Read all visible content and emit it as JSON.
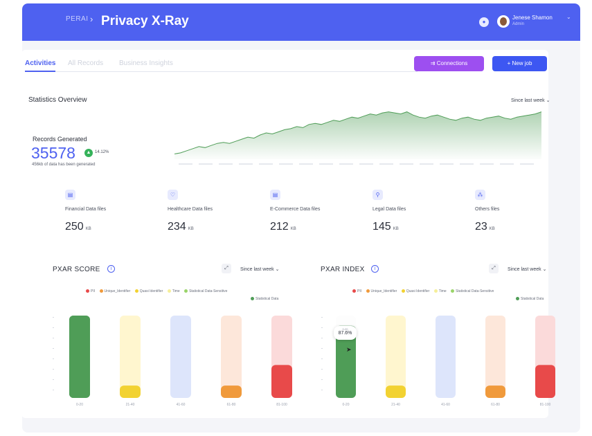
{
  "header": {
    "breadcrumb_root": "PERAI",
    "breadcrumb_sep": "›",
    "title": "Privacy X-Ray",
    "user_name": "Jenese Shamon",
    "user_role": "Admin",
    "icons": [
      "bell-icon",
      "avatar",
      "chevron-down-icon"
    ]
  },
  "tabs": [
    {
      "label": "Activities",
      "active": true
    },
    {
      "label": "All Records",
      "active": false
    },
    {
      "label": "Business Insights",
      "active": false
    }
  ],
  "actions": {
    "connections_label": "⇉ Connections",
    "new_job_label": "+ New job"
  },
  "overview": {
    "title": "Statistics Overview",
    "range": "Since last week ⌄",
    "records_label": "Records Generated",
    "records_value": "35578",
    "growth": "14.12%",
    "sub": "456kb of data has been generated"
  },
  "stats": [
    {
      "label": "Financial Data files",
      "value": "250",
      "unit": "KB",
      "icon": "▤"
    },
    {
      "label": "Healthcare Data files",
      "value": "234",
      "unit": "KB",
      "icon": "♡"
    },
    {
      "label": "E-Commerce Data files",
      "value": "212",
      "unit": "KB",
      "icon": "▤"
    },
    {
      "label": "Legal Data files",
      "value": "145",
      "unit": "KB",
      "icon": "⚲"
    },
    {
      "label": "Others files",
      "value": "23",
      "unit": "KB",
      "icon": "⁂"
    }
  ],
  "score": {
    "title": "PXAR SCORE",
    "range": "Since last week ⌄"
  },
  "index": {
    "title": "PXAR INDEX",
    "range": "Since last week ⌄"
  },
  "legend": [
    {
      "label": "PII",
      "color": "#e84a4a"
    },
    {
      "label": "Unique_Identifier",
      "color": "#f09a3c"
    },
    {
      "label": "Quasi Identifier",
      "color": "#f2d232"
    },
    {
      "label": "Time",
      "color": "#f5ef9a"
    },
    {
      "label": "Statistical Data-Sensitive",
      "color": "#9ad46a"
    },
    {
      "label": "Statistical Data",
      "color": "#4f9d57"
    }
  ],
  "tooltip": {
    "category": "0-20",
    "value": "87.6%"
  },
  "chart_data": [
    {
      "type": "area",
      "title": "Statistics Overview",
      "values": [
        10,
        12,
        16,
        20,
        24,
        22,
        26,
        30,
        32,
        30,
        34,
        38,
        42,
        40,
        46,
        50,
        48,
        52,
        56,
        58,
        62,
        60,
        66,
        68,
        66,
        70,
        74,
        72,
        76,
        80,
        78,
        82,
        86,
        84,
        88,
        90,
        88,
        86,
        90,
        84,
        80,
        78,
        82,
        84,
        80,
        76,
        74,
        78,
        80,
        76,
        74,
        78,
        80,
        82,
        78,
        76,
        80,
        82,
        84,
        86,
        90
      ],
      "color": "#4f9d57"
    },
    {
      "type": "bar",
      "title": "PXAR SCORE",
      "categories": [
        "0-20",
        "21-40",
        "41-60",
        "61-80",
        "81-100"
      ],
      "series": [
        {
          "name": "value",
          "values": [
            100,
            15,
            0,
            15,
            40
          ]
        }
      ],
      "colors": [
        "#4f9d57",
        "#f2d232",
        "#a9bdf5",
        "#f09a3c",
        "#e84a4a"
      ],
      "track_colors": [
        "#4f9d57",
        "#fff6cf",
        "#dde5fb",
        "#fde7da",
        "#fbdada"
      ],
      "ylim": [
        0,
        100
      ]
    },
    {
      "type": "bar",
      "title": "PXAR INDEX",
      "categories": [
        "0-20",
        "21-40",
        "41-60",
        "61-80",
        "81-100"
      ],
      "series": [
        {
          "name": "value",
          "values": [
            87.6,
            15,
            0,
            15,
            40
          ]
        }
      ],
      "colors": [
        "#4f9d57",
        "#f2d232",
        "#a9bdf5",
        "#f09a3c",
        "#e84a4a"
      ],
      "track_colors": [
        "#fdfdfd",
        "#fff6cf",
        "#dde5fb",
        "#fde7da",
        "#fbdada"
      ],
      "ylim": [
        0,
        100
      ]
    }
  ]
}
